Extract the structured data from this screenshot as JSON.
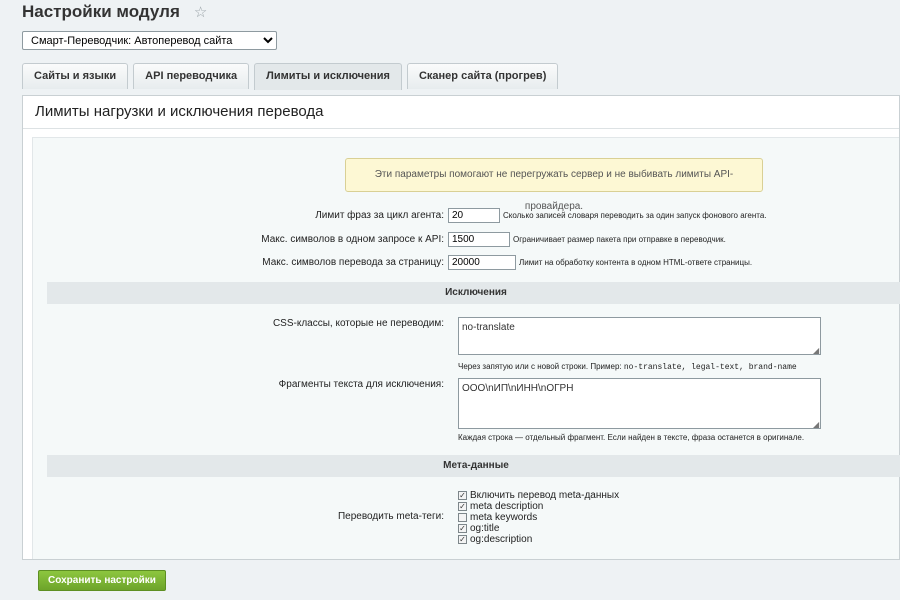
{
  "header": {
    "title": "Настройки модуля",
    "star_icon": "star-icon"
  },
  "module_select": {
    "value": "Смарт-Переводчик: Автоперевод сайта"
  },
  "tabs": [
    {
      "label": "Сайты и языки"
    },
    {
      "label": "API переводчика"
    },
    {
      "label": "Лимиты и исключения"
    },
    {
      "label": "Сканер сайта (прогрев)"
    }
  ],
  "panel": {
    "title": "Лимиты нагрузки и исключения перевода",
    "notice": "Эти параметры помогают не перегружать сервер и не выбивать лимиты API-провайдера."
  },
  "limits": [
    {
      "label": "Лимит фраз за цикл агента:",
      "value": "20",
      "hint": "Сколько записей словаря переводить за один запуск фонового агента."
    },
    {
      "label": "Макс. символов в одном запросе к API:",
      "value": "1500",
      "hint": "Ограничивает размер пакета при отправке в переводчик."
    },
    {
      "label": "Макс. символов перевода за страницу:",
      "value": "20000",
      "hint": "Лимит на обработку контента в одном HTML-ответе страницы."
    }
  ],
  "exclusions": {
    "heading": "Исключения",
    "css_label": "CSS-классы, которые не переводим:",
    "css_value": "no-translate",
    "css_hint_prefix": "Через запятую или с новой строки. Пример:",
    "css_hint_example": "no-translate, legal-text, brand-name",
    "fragments_label": "Фрагменты текста для исключения:",
    "fragments_value": "ООО\\nИП\\nИНН\\nОГРН",
    "fragments_hint": "Каждая строка — отдельный фрагмент. Если найден в тексте, фраза останется в оригинале."
  },
  "meta": {
    "heading": "Мета-данные",
    "label": "Переводить meta-теги:",
    "options": [
      {
        "label": "Включить перевод meta-данных",
        "checked": true
      },
      {
        "label": "meta description",
        "checked": true
      },
      {
        "label": "meta keywords",
        "checked": false
      },
      {
        "label": "og:title",
        "checked": true
      },
      {
        "label": "og:description",
        "checked": true
      }
    ]
  },
  "actions": {
    "save_label": "Сохранить настройки"
  },
  "colors": {
    "accent": "#7ab536",
    "notice_bg": "#fdf8d4",
    "section_bg": "#e3e8ea"
  }
}
